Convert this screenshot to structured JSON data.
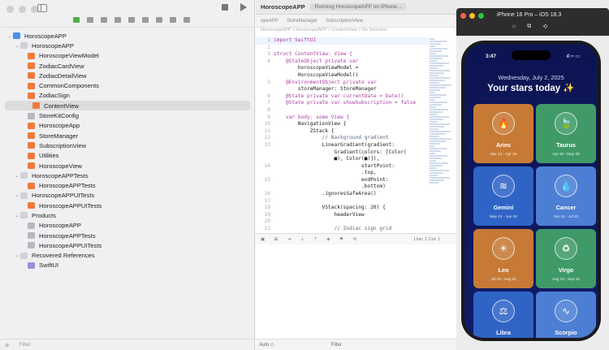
{
  "navigator": {
    "filter_placeholder": "Filter",
    "tree": [
      {
        "label": "HoroscopeAPP",
        "level": 0,
        "kind": "proj",
        "expand": "v"
      },
      {
        "label": "HoroscopeAPP",
        "level": 1,
        "kind": "folder",
        "expand": "v"
      },
      {
        "label": "HoroscopeViewModel",
        "level": 2,
        "kind": "swift",
        "expand": ""
      },
      {
        "label": "ZodiacCardView",
        "level": 2,
        "kind": "swift",
        "expand": ""
      },
      {
        "label": "ZodiacDetailView",
        "level": 2,
        "kind": "swift",
        "expand": ""
      },
      {
        "label": "CommonComponents",
        "level": 2,
        "kind": "swift",
        "expand": ""
      },
      {
        "label": "ZodiacSign",
        "level": 2,
        "kind": "swift",
        "expand": ""
      },
      {
        "label": "ContentView",
        "level": 2,
        "kind": "swift",
        "expand": "",
        "selected": true
      },
      {
        "label": "StoreKitConfig",
        "level": 2,
        "kind": "gray",
        "expand": ""
      },
      {
        "label": "HoroscopeApp",
        "level": 2,
        "kind": "swift",
        "expand": ""
      },
      {
        "label": "StoreManager",
        "level": 2,
        "kind": "swift",
        "expand": ""
      },
      {
        "label": "SubscriptionView",
        "level": 2,
        "kind": "swift",
        "expand": ""
      },
      {
        "label": "Utilities",
        "level": 2,
        "kind": "swift",
        "expand": ""
      },
      {
        "label": "HoroscopeView",
        "level": 2,
        "kind": "swift",
        "expand": ""
      },
      {
        "label": "HoroscopeAPPTests",
        "level": 1,
        "kind": "folder",
        "expand": "v"
      },
      {
        "label": "HoroscopeAPPTests",
        "level": 2,
        "kind": "swift",
        "expand": ""
      },
      {
        "label": "HoroscopeAPPUITests",
        "level": 1,
        "kind": "folder",
        "expand": "v"
      },
      {
        "label": "HoroscopeAPPUITests",
        "level": 2,
        "kind": "swift",
        "expand": ""
      },
      {
        "label": "Products",
        "level": 1,
        "kind": "folder",
        "expand": "v"
      },
      {
        "label": "HoroscopeAPP",
        "level": 2,
        "kind": "gray",
        "expand": ""
      },
      {
        "label": "HoroscopeAPPTests",
        "level": 2,
        "kind": "gray",
        "expand": ""
      },
      {
        "label": "HoroscopeAPPUITests",
        "level": 2,
        "kind": "gray",
        "expand": ""
      },
      {
        "label": "Recovered References",
        "level": 1,
        "kind": "folder",
        "expand": "v"
      },
      {
        "label": "SwiftUI",
        "level": 2,
        "kind": "pkg",
        "expand": ""
      }
    ]
  },
  "editor": {
    "title": "HoroscopeAPP",
    "status": "Running HoroscopeAPP on iPhone...",
    "tabs": [
      "opeAPP",
      "StoreManager",
      "SubscriptionView"
    ],
    "breadcrumb": "HoroscopeAPP > HoroscopeAPP > ContentView > No Selection",
    "code": [
      {
        "n": "1",
        "t": "import SwiftUI"
      },
      {
        "n": "2",
        "t": ""
      },
      {
        "n": "3",
        "t": "struct ContentView: View {"
      },
      {
        "n": "4",
        "t": "    @StateObject private var"
      },
      {
        "n": "",
        "t": "        horoscopeViewModel ="
      },
      {
        "n": "",
        "t": "        HoroscopeViewModel()"
      },
      {
        "n": "5",
        "t": "    @EnvironmentObject private var"
      },
      {
        "n": "",
        "t": "        storeManager: StoreManager"
      },
      {
        "n": "6",
        "t": "    @State private var currentDate = Date()"
      },
      {
        "n": "7",
        "t": "    @State private var showSubscription = false"
      },
      {
        "n": "8",
        "t": ""
      },
      {
        "n": "9",
        "t": "    var body: some View {"
      },
      {
        "n": "10",
        "t": "        NavigationView {"
      },
      {
        "n": "11",
        "t": "            ZStack {"
      },
      {
        "n": "12",
        "t": "                // Background gradient"
      },
      {
        "n": "13",
        "t": "                LinearGradient(gradient:"
      },
      {
        "n": "",
        "t": "                    Gradient(colors: [Color("
      },
      {
        "n": "",
        "t": "                    ■), Color(■)]),"
      },
      {
        "n": "14",
        "t": "                             startPoint:"
      },
      {
        "n": "",
        "t": "                             .top,"
      },
      {
        "n": "15",
        "t": "                             endPoint:"
      },
      {
        "n": "",
        "t": "                             .bottom)"
      },
      {
        "n": "16",
        "t": "                .ignoresSafeArea()"
      },
      {
        "n": "17",
        "t": ""
      },
      {
        "n": "18",
        "t": "                VStack(spacing: 20) {"
      },
      {
        "n": "19",
        "t": "                    headerView"
      },
      {
        "n": "20",
        "t": ""
      },
      {
        "n": "21",
        "t": "                    // Zodiac sign grid"
      }
    ],
    "cursor": "Line: 1  Col: 1",
    "scheme": "Auto ◇",
    "filter_placeholder": "Filter"
  },
  "simulator": {
    "title": "iPhone 16 Pro – iOS 18.3",
    "time": "3:47",
    "date": "Wednesday, July 2, 2025",
    "header": "Your stars today ✨",
    "signs": [
      {
        "name": "Aries",
        "dates": "Mar 21 - Apr 19",
        "icon": "🔥",
        "color": "#c77a36"
      },
      {
        "name": "Taurus",
        "dates": "Apr 20 - May 20",
        "icon": "🍃",
        "color": "#3f9a68"
      },
      {
        "name": "Gemini",
        "dates": "May 21 - Jun 20",
        "icon": "≋",
        "color": "#2f64c6"
      },
      {
        "name": "Cancer",
        "dates": "Jun 21 - Jul 22",
        "icon": "💧",
        "color": "#4c7fd4"
      },
      {
        "name": "Leo",
        "dates": "Jul 23 - Aug 22",
        "icon": "☀",
        "color": "#c77a36"
      },
      {
        "name": "Virgo",
        "dates": "Aug 23 - Sep 22",
        "icon": "♻",
        "color": "#3f9a68"
      },
      {
        "name": "Libra",
        "dates": "",
        "icon": "⚖",
        "color": "#2f64c6"
      },
      {
        "name": "Scorpio",
        "dates": "",
        "icon": "∿",
        "color": "#4c7fd4"
      }
    ]
  },
  "colors": {
    "traffic_red": "#fe5f57",
    "traffic_yellow": "#febc2e",
    "traffic_green": "#28c840",
    "keyword": "#ad3da4",
    "type": "#3900a0"
  }
}
